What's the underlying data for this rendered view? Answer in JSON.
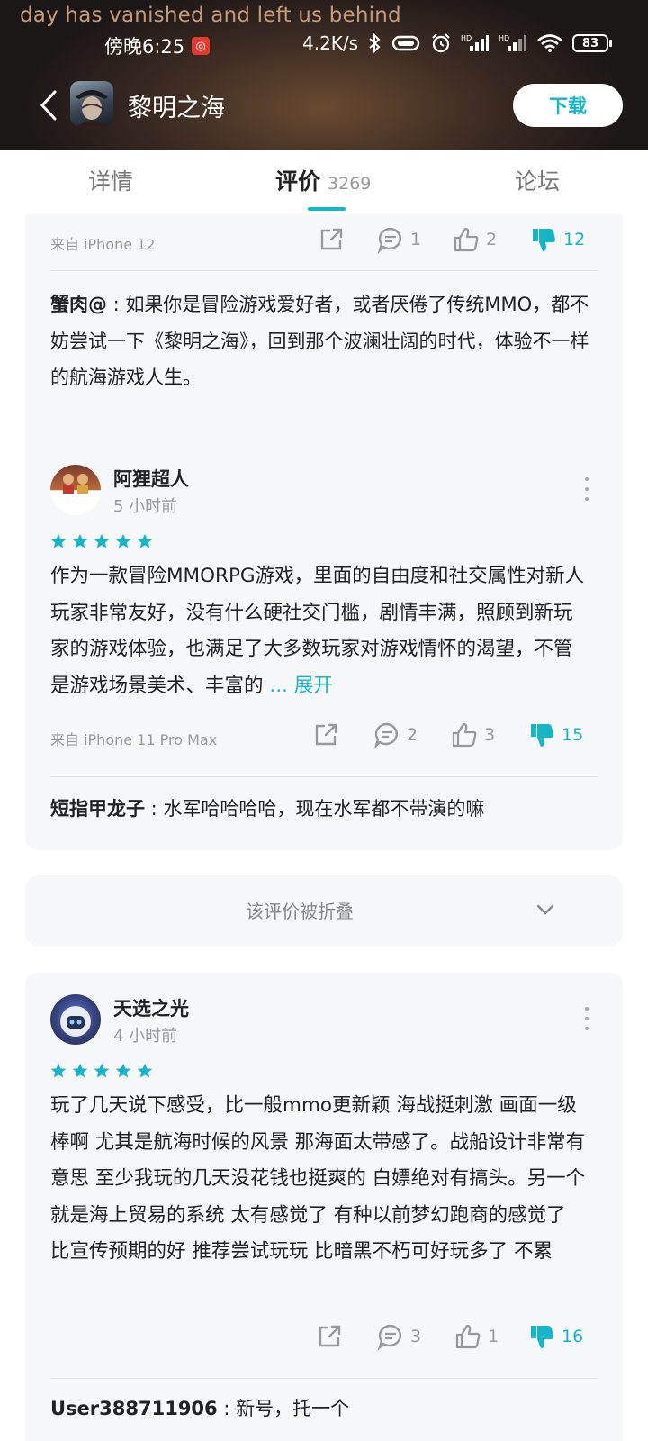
{
  "status_bar": {
    "lyric": "day has vanished and left us behind",
    "time": "傍晚6:25",
    "app_badge": "◎",
    "net_speed": "4.2K/s",
    "battery": "83"
  },
  "header": {
    "app_name": "黎明之海",
    "download_label": "下载"
  },
  "tabs": {
    "detail": "详情",
    "review": "评价",
    "review_count": "3269",
    "forum": "论坛"
  },
  "reviews": [
    {
      "source": "来自 iPhone 12",
      "comments": "1",
      "likes": "2",
      "dislikes": "12",
      "reply_user": "蟹肉@",
      "reply_text": "如果你是冒险游戏爱好者，或者厌倦了传统MMO，都不妨尝试一下《黎明之海》，回到那个波澜壮阔的时代，体验不一样的航海游戏人生。"
    },
    {
      "user": "阿狸超人",
      "time": "5 小时前",
      "rating": 5,
      "text": "作为一款冒险MMORPG游戏，里面的自由度和社交属性对新人玩家非常友好，没有什么硬社交门槛，剧情丰满，照顾到新玩家的游戏体验，也满足了大多数玩家对游戏情怀的渴望，不管是游戏场景美术、丰富的",
      "ellipsis": "...",
      "expand_label": "展开",
      "source": "来自 iPhone 11 Pro Max",
      "comments": "2",
      "likes": "3",
      "dislikes": "15",
      "reply_user": "短指甲龙子",
      "reply_text": "水军哈哈哈哈，现在水军都不带演的嘛"
    },
    {
      "folded_label": "该评价被折叠"
    },
    {
      "user": "天选之光",
      "time": "4 小时前",
      "rating": 5,
      "text": "玩了几天说下感受，比一般mmo更新颖 海战挺刺激 画面一级棒啊 尤其是航海时候的风景 那海面太带感了。战船设计非常有意思 至少我玩的几天没花钱也挺爽的 白嫖绝对有搞头。另一个就是海上贸易的系统 太有感觉了 有种以前梦幻跑商的感觉了 比宣传预期的好 推荐尝试玩玩 比暗黑不朽可好玩多了 不累",
      "comments": "3",
      "likes": "1",
      "dislikes": "16",
      "reply_user": "User388711906",
      "reply_text": "新号，托一个"
    }
  ],
  "colors": {
    "accent": "#14b5c5",
    "card_bg": "#f6f7f9",
    "muted_text": "#999999"
  }
}
